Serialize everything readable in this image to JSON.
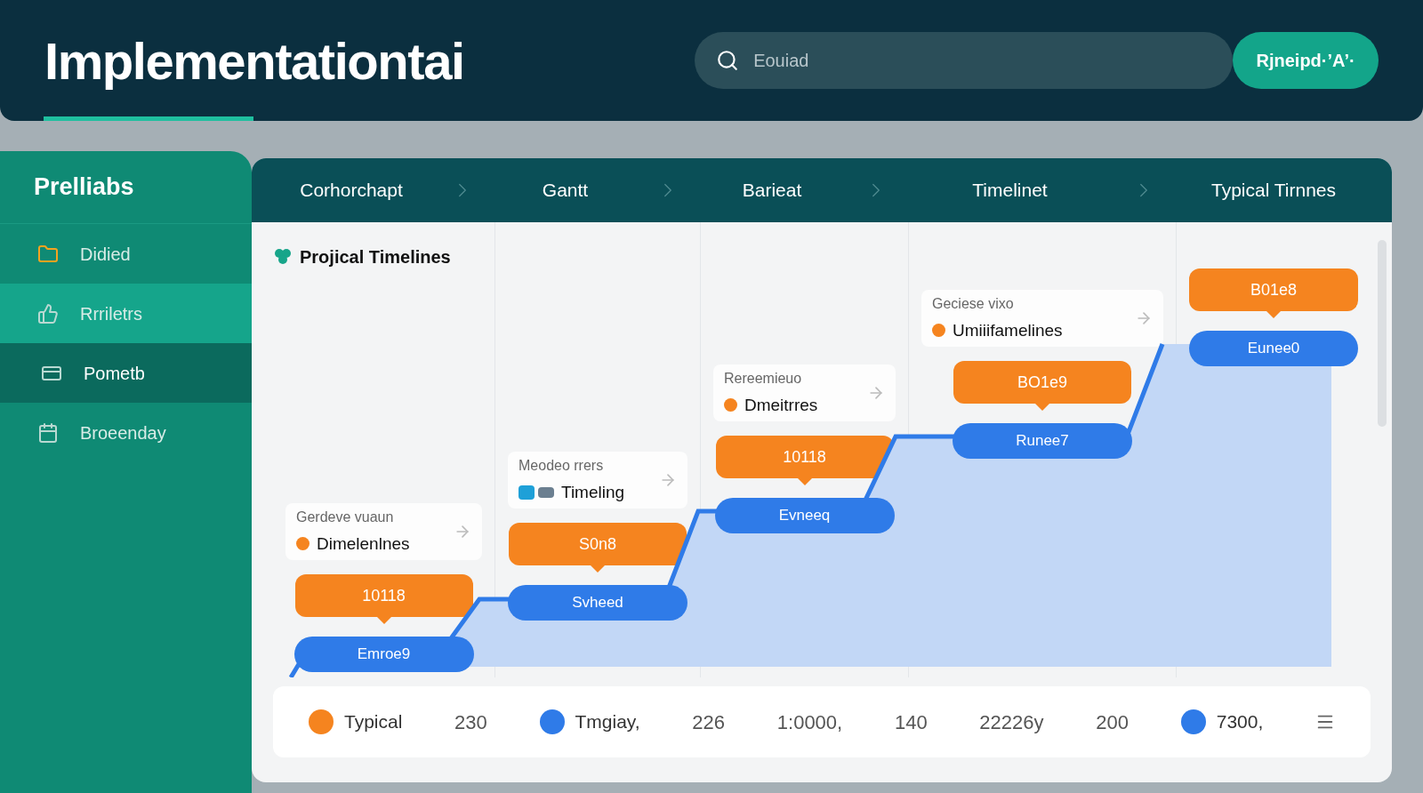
{
  "header": {
    "title": "Implementationtai",
    "search": {
      "placeholder": "Eouiad"
    },
    "button": "Rjneipd·’A’·"
  },
  "sidebar": {
    "title": "Prelliabs",
    "items": [
      {
        "label": "Didied",
        "selected": false,
        "hover": false,
        "kind": "folder"
      },
      {
        "label": "Rrriletrs",
        "selected": true,
        "hover": false,
        "kind": "thumb"
      },
      {
        "label": "Pometb",
        "selected": false,
        "hover": true,
        "kind": "card"
      },
      {
        "label": "Broeenday",
        "selected": false,
        "hover": false,
        "kind": "calendar"
      }
    ]
  },
  "tabs": [
    {
      "label": "Corhorchapt"
    },
    {
      "label": "Gantt"
    },
    {
      "label": "Barieat"
    },
    {
      "label": "Timelinet"
    },
    {
      "label": "Typical Tirnnes"
    }
  ],
  "chart_title": "Projical Timelines",
  "stages": [
    {
      "caption": "Gerdeve vuaun",
      "label": "Dimelenlnes",
      "kind": "dot",
      "tag": "10118",
      "pill": "Emroe9"
    },
    {
      "caption": "Meodeo rrers",
      "label": "Timeling",
      "kind": "icons",
      "tag": "S0n8",
      "pill": "Svheed"
    },
    {
      "caption": "Rereemieuo",
      "label": "Dmeitrres",
      "kind": "dot",
      "tag": "10118",
      "pill": "Evneeq"
    },
    {
      "caption": "Geciese vixo",
      "label": "Umiiifamelines",
      "kind": "dot",
      "tag": "BO1e9",
      "pill": "Runee7"
    },
    {
      "tag": "B01e8",
      "pill": "Eunee0"
    }
  ],
  "legend": [
    {
      "kind": "series",
      "label": "Typical",
      "color": "#f5841f"
    },
    {
      "kind": "value",
      "label": "230"
    },
    {
      "kind": "series",
      "label": "Tmgiay,",
      "color": "#2f7be8"
    },
    {
      "kind": "value",
      "label": "226"
    },
    {
      "kind": "value",
      "label": "1:0000,"
    },
    {
      "kind": "value",
      "label": "140"
    },
    {
      "kind": "value",
      "label": "22226y"
    },
    {
      "kind": "value",
      "label": "200"
    },
    {
      "kind": "series",
      "label": "7300,",
      "color": "#2f7be8"
    },
    {
      "kind": "menu"
    }
  ]
}
